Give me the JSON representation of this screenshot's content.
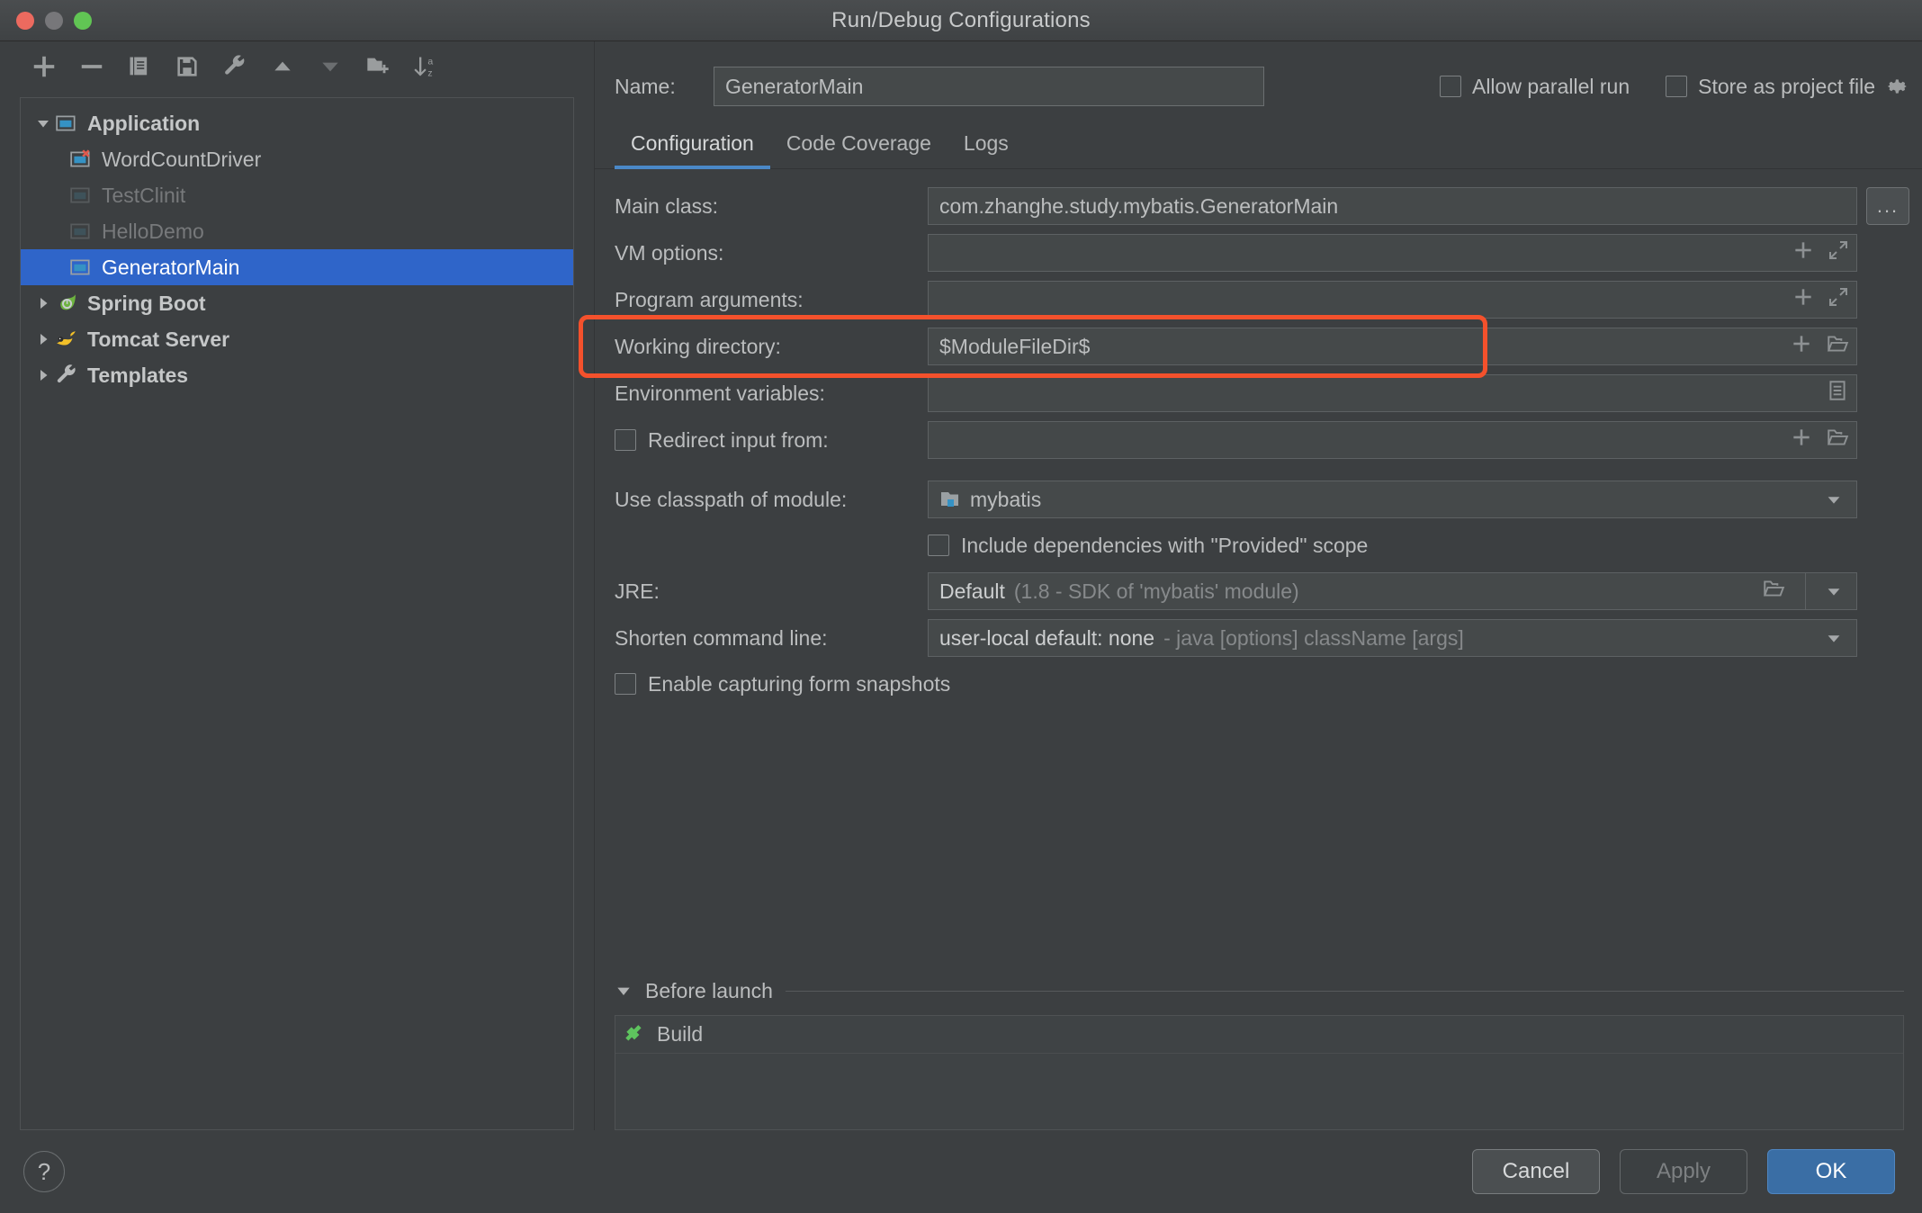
{
  "window": {
    "title": "Run/Debug Configurations",
    "traffic_lights": [
      "close",
      "minimize",
      "zoom"
    ]
  },
  "sidebar": {
    "toolbar": [
      {
        "name": "add-configuration-button",
        "icon": "plus-icon"
      },
      {
        "name": "remove-configuration-button",
        "icon": "minus-icon"
      },
      {
        "name": "copy-configuration-button",
        "icon": "copy-icon"
      },
      {
        "name": "save-configuration-button",
        "icon": "save-icon"
      },
      {
        "name": "edit-templates-button",
        "icon": "wrench-icon"
      },
      {
        "name": "move-up-button",
        "icon": "triangle-up-icon"
      },
      {
        "name": "move-down-button",
        "icon": "triangle-down-icon"
      },
      {
        "name": "create-folder-button",
        "icon": "folder-add-icon"
      },
      {
        "name": "sort-configurations-button",
        "icon": "sort-az-icon"
      }
    ],
    "tree": [
      {
        "label": "Application",
        "level": 0,
        "icon": "application-icon",
        "expanded": true,
        "state": "group",
        "selected": false
      },
      {
        "label": "WordCountDriver",
        "level": 1,
        "icon": "application-error-icon",
        "state": "normal",
        "selected": false
      },
      {
        "label": "TestClinit",
        "level": 1,
        "icon": "application-icon",
        "state": "disabled",
        "selected": false
      },
      {
        "label": "HelloDemo",
        "level": 1,
        "icon": "application-icon",
        "state": "disabled",
        "selected": false
      },
      {
        "label": "GeneratorMain",
        "level": 1,
        "icon": "application-icon",
        "state": "normal",
        "selected": true
      },
      {
        "label": "Spring Boot",
        "level": 0,
        "icon": "spring-boot-icon",
        "expanded": false,
        "state": "group",
        "selected": false
      },
      {
        "label": "Tomcat Server",
        "level": 0,
        "icon": "tomcat-icon",
        "expanded": false,
        "state": "group",
        "selected": false
      },
      {
        "label": "Templates",
        "level": 0,
        "icon": "wrench-icon",
        "expanded": false,
        "state": "group",
        "selected": false
      }
    ]
  },
  "header": {
    "name_label": "Name:",
    "name_value": "GeneratorMain",
    "allow_parallel_run": {
      "label": "Allow parallel run",
      "checked": false
    },
    "store_as_project_file": {
      "label": "Store as project file",
      "checked": false
    },
    "gear_icon": "gear-icon"
  },
  "tabs": [
    {
      "label": "Configuration",
      "active": true
    },
    {
      "label": "Code Coverage",
      "active": false
    },
    {
      "label": "Logs",
      "active": false
    }
  ],
  "form": {
    "main_class": {
      "label": "Main class:",
      "value": "com.zhanghe.study.mybatis.GeneratorMain",
      "browse_label": "...",
      "actions": []
    },
    "vm_options": {
      "label": "VM options:",
      "value": "",
      "actions": [
        "plus-icon",
        "expand-icon"
      ]
    },
    "program_arguments": {
      "label": "Program arguments:",
      "value": "",
      "actions": [
        "plus-icon",
        "expand-icon"
      ]
    },
    "working_directory": {
      "label": "Working directory:",
      "value": "$ModuleFileDir$",
      "actions": [
        "plus-icon",
        "folder-icon"
      ],
      "highlighted": true
    },
    "environment_variables": {
      "label": "Environment variables:",
      "value": "",
      "actions": [
        "list-icon"
      ]
    },
    "redirect_input": {
      "label": "Redirect input from:",
      "value": "",
      "checked": false,
      "actions": [
        "plus-icon",
        "folder-icon"
      ]
    },
    "classpath_module": {
      "label": "Use classpath of module:",
      "value": "mybatis",
      "icon": "module-icon"
    },
    "include_provided": {
      "label": "Include dependencies with \"Provided\" scope",
      "checked": false
    },
    "jre": {
      "label": "JRE:",
      "value_strong": "Default",
      "value_dim": "(1.8 - SDK of 'mybatis' module)"
    },
    "shorten_command": {
      "label": "Shorten command line:",
      "value_strong": "user-local default: none",
      "value_dim": "- java [options] className [args]"
    },
    "form_snapshots": {
      "label": "Enable capturing form snapshots",
      "checked": false
    }
  },
  "before_launch": {
    "title": "Before launch",
    "expanded": true,
    "items": [
      {
        "label": "Build",
        "icon": "build-hammer-icon"
      }
    ]
  },
  "footer": {
    "help_label": "?",
    "cancel_label": "Cancel",
    "apply_label": "Apply",
    "ok_label": "OK"
  },
  "colors": {
    "background": "#3c3f41",
    "field_background": "#45494a",
    "selection_blue": "#2f65c9",
    "accent_blue": "#4a88c7",
    "ok_button": "#3a6ea5",
    "annotation_red": "#f4512c",
    "build_green": "#5ec45e",
    "text_primary": "#bbbdbe",
    "text_dim": "#77797b"
  }
}
